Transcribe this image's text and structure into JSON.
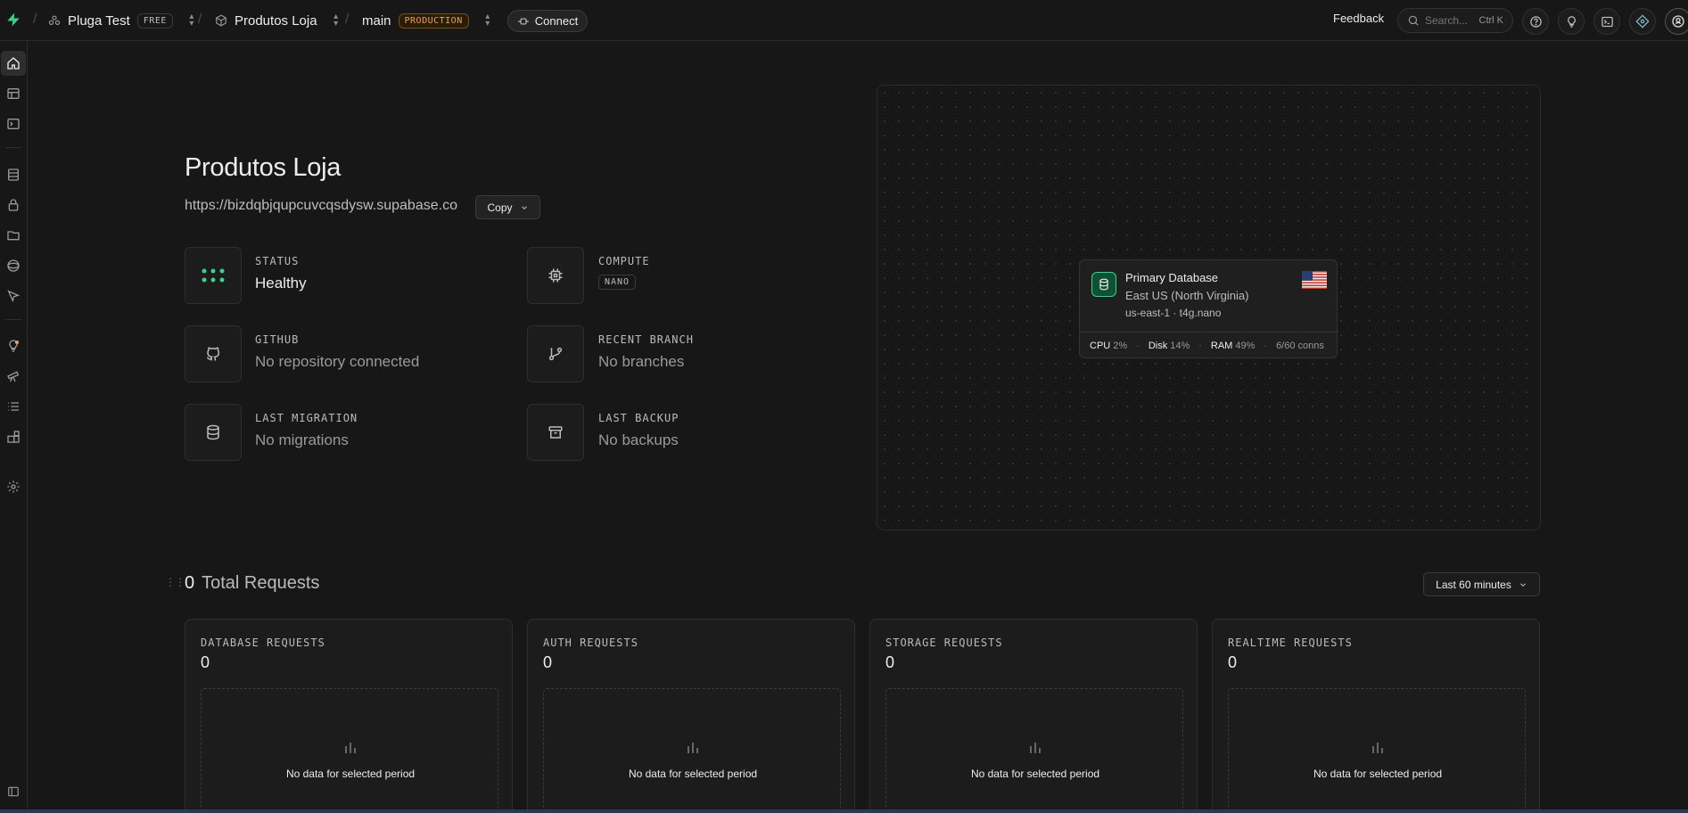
{
  "topbar": {
    "org_name": "Pluga Test",
    "org_badge": "FREE",
    "project_name": "Produtos Loja",
    "branch_name": "main",
    "branch_badge": "PRODUCTION",
    "connect_label": "Connect",
    "feedback_label": "Feedback",
    "search_placeholder": "Search...",
    "search_shortcut": "Ctrl K",
    "separator": "/"
  },
  "project": {
    "title": "Produtos Loja",
    "url": "https://bizdqbjqupcuvcqsdysw.supabase.co",
    "copy_label": "Copy"
  },
  "info": {
    "status_label": "STATUS",
    "status_value": "Healthy",
    "compute_label": "COMPUTE",
    "compute_value": "NANO",
    "github_label": "GITHUB",
    "github_value": "No repository connected",
    "branch_label": "RECENT BRANCH",
    "branch_value": "No branches",
    "migration_label": "LAST MIGRATION",
    "migration_value": "No migrations",
    "backup_label": "LAST BACKUP",
    "backup_value": "No backups"
  },
  "database": {
    "title": "Primary Database",
    "region": "East US (North Virginia)",
    "zone": "us-east-1 · t4g.nano",
    "cpu_label": "CPU",
    "cpu_value": "2%",
    "disk_label": "Disk",
    "disk_value": "14%",
    "ram_label": "RAM",
    "ram_value": "49%",
    "conns": "6/60 conns",
    "dot": "·"
  },
  "requests": {
    "total": "0",
    "title": "Total Requests",
    "period": "Last 60 minutes",
    "cards": [
      {
        "label": "DATABASE REQUESTS",
        "value": "0",
        "empty": "No data for selected period"
      },
      {
        "label": "AUTH REQUESTS",
        "value": "0",
        "empty": "No data for selected period"
      },
      {
        "label": "STORAGE REQUESTS",
        "value": "0",
        "empty": "No data for selected period"
      },
      {
        "label": "REALTIME REQUESTS",
        "value": "0",
        "empty": "No data for selected period"
      }
    ]
  },
  "colors": {
    "brand": "#3ecf8e",
    "production": "#f0a04b",
    "background": "#171717"
  }
}
